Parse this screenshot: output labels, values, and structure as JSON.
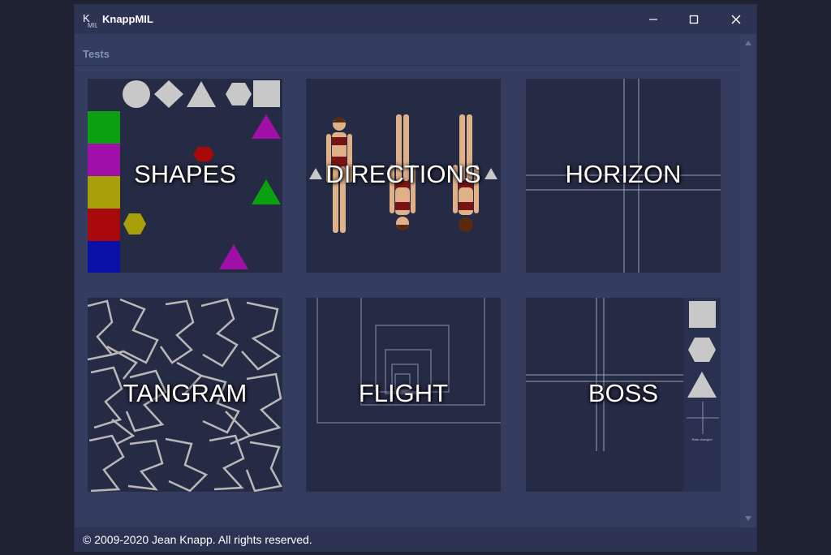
{
  "app": {
    "title": "KnappMIL",
    "logo_icon": "knappmil-logo-icon"
  },
  "window_controls": {
    "minimize_icon": "minimize-icon",
    "maximize_icon": "maximize-icon",
    "close_icon": "close-icon"
  },
  "section": {
    "label": "Tests"
  },
  "tests": [
    {
      "label": "SHAPES"
    },
    {
      "label": "DIRECTIONS"
    },
    {
      "label": "HORIZON"
    },
    {
      "label": "TANGRAM"
    },
    {
      "label": "FLIGHT"
    },
    {
      "label": "BOSS",
      "status_text": "Rate changed"
    }
  ],
  "footer": {
    "copyright": "© 2009-2020 Jean Knapp. All rights reserved."
  },
  "colors": {
    "window_bg": "#343d60",
    "titlebar": "#2d3453",
    "tile_bg": "#262b45",
    "shape_gray": "#c8c8c8"
  }
}
